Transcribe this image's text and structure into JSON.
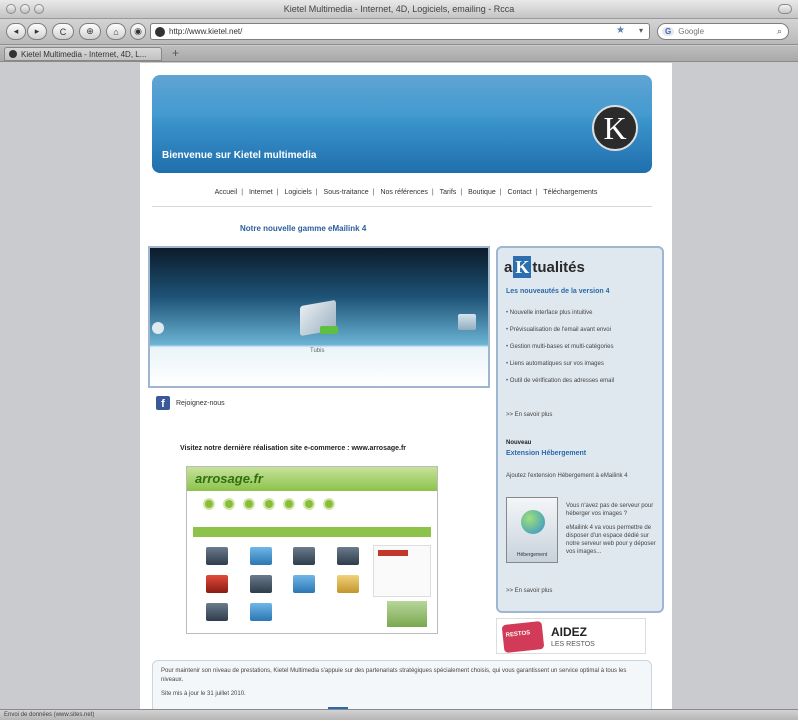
{
  "browser": {
    "window_title": "Kietel Multimedia - Internet, 4D, Logiciels, emailing - Rcca",
    "url": "http://www.kietel.net/",
    "search_placeholder": "Google",
    "search_engine": "G",
    "tab_label": "Kietel Multimedia - Internet, 4D, L...",
    "new_tab": "+",
    "status_text": "Envoi de données (www.sites.net)",
    "nav": {
      "back": "◂",
      "forward": "▸",
      "reload": "C",
      "home": "⌂",
      "stop": "⊕"
    }
  },
  "site": {
    "banner_title": "Bienvenue sur Kietel multimedia",
    "logo_letter": "K",
    "menu": [
      "Accueil",
      "Internet",
      "Logiciels",
      "Sous-traitance",
      "Nos références",
      "Tarifs",
      "Boutique",
      "Contact",
      "Téléchargements"
    ],
    "promo_title": "Notre nouvelle gamme eMailink 4",
    "slider_caption": "Tubis",
    "facebook_label": "Rejoignez-nous",
    "visit_text": "Visitez notre dernière réalisation site e-commerce : www.arrosage.fr",
    "showcase_logo": "arrosage.fr",
    "sidebar": {
      "heading_pre": "a",
      "heading_k": "K",
      "heading_post": "tualités",
      "subtitle": "Les nouveautés de la version 4",
      "items": [
        "Nouvelle interface plus intuitive",
        "Prévisualisation de l'email avant envoi",
        "Gestion multi-bases et multi-catégories",
        "Liens automatiques sur vos images",
        "Outil de vérification des adresses email"
      ],
      "more1": ">> En savoir plus",
      "new_label": "Nouveau",
      "extension_title": "Extension Hébergement",
      "extension_desc": "Ajoutez l'extension Hébergement à eMailink 4",
      "icon_label": "Hébergement",
      "text_p1": "Vous n'avez pas de serveur pour héberger vos images ?",
      "text_p2": "eMailink 4 va vous permettre de disposer d'un espace dédié sur notre serveur web pour y déposer vos images...",
      "more2": ">> En savoir plus"
    },
    "aidez": {
      "badge": "RESTOS",
      "title": "AIDEZ",
      "subtitle": "LES RESTOS"
    },
    "info_text": "Pour maintenir son niveau de prestations, Kietel Multimedia s'appuie sur des partenariats stratégiques spécialement choisis, qui vous garantissent un service optimal à tous les niveaux.",
    "updated_text": "Site mis à jour le 31 juillet 2010."
  }
}
